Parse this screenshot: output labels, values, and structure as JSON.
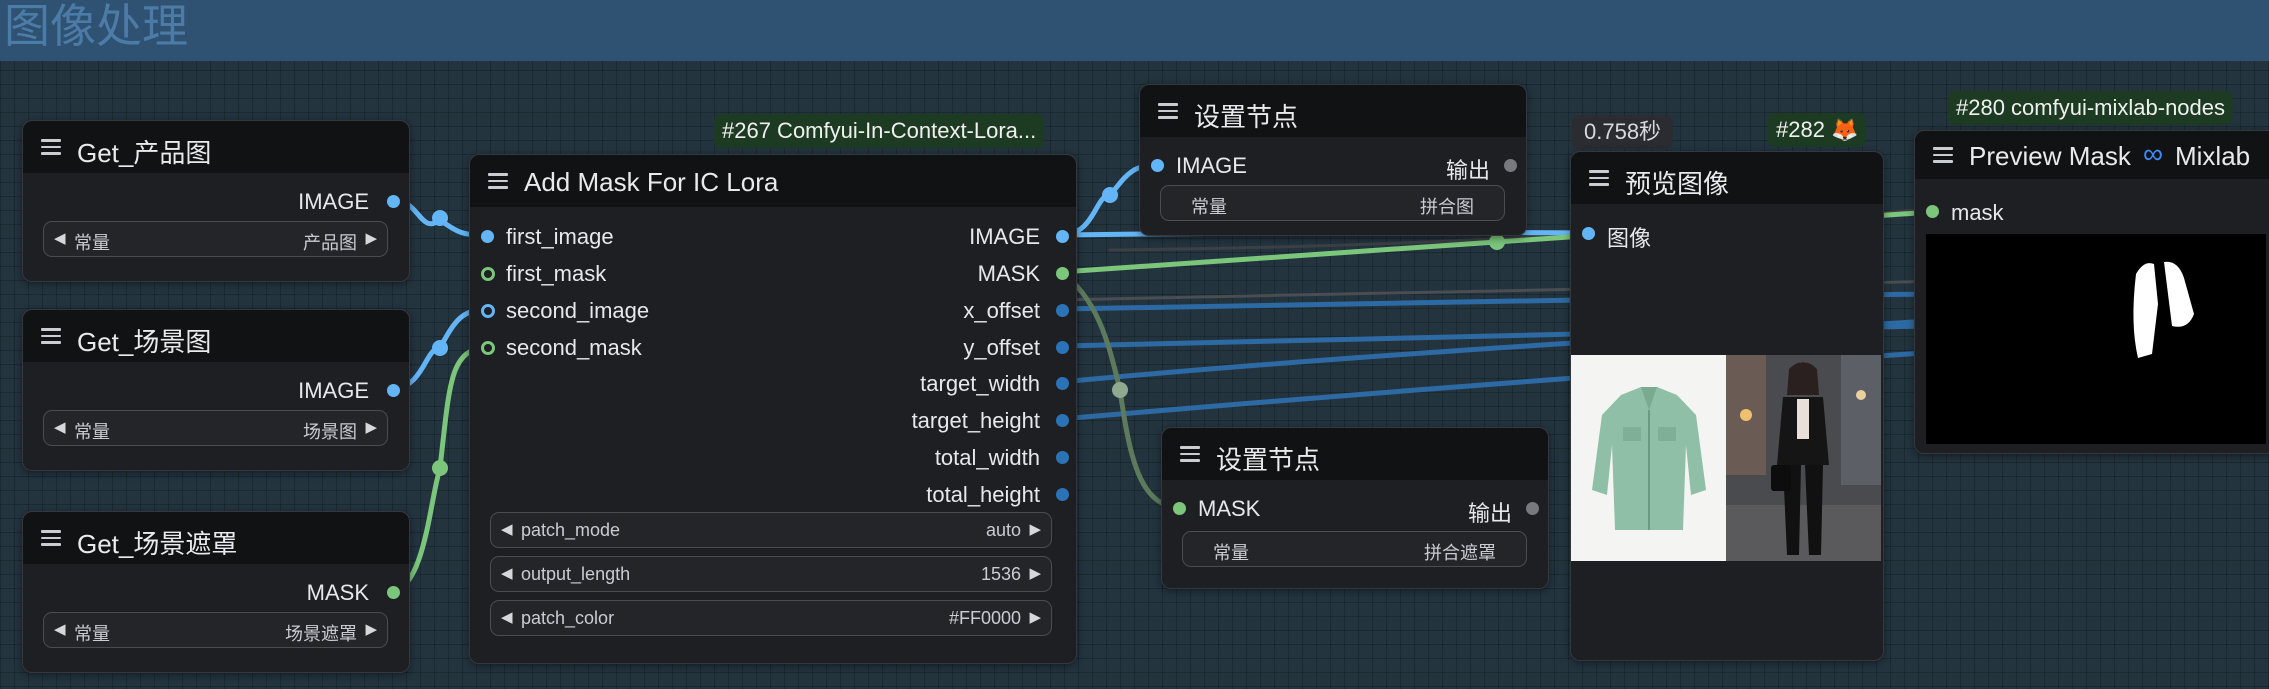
{
  "group": {
    "title": "图像处理"
  },
  "colors": {
    "image": "#64b5f6",
    "mask": "#7bc67b",
    "int": "#2b73b6",
    "badge_bg": "#1d3a22",
    "group_header": "#2f5272"
  },
  "nodes": {
    "get_product": {
      "title": "Get_产品图",
      "output": "IMAGE",
      "widget": {
        "label": "常量",
        "value": "产品图"
      }
    },
    "get_scene": {
      "title": "Get_场景图",
      "output": "IMAGE",
      "widget": {
        "label": "常量",
        "value": "场景图"
      }
    },
    "get_scene_mask": {
      "title": "Get_场景遮罩",
      "output": "MASK",
      "widget": {
        "label": "常量",
        "value": "场景遮罩"
      }
    },
    "add_mask": {
      "badge": "#267 Comfyui-In-Context-Lora...",
      "title": "Add Mask For IC Lora",
      "inputs": [
        "first_image",
        "first_mask",
        "second_image",
        "second_mask"
      ],
      "outputs": [
        "IMAGE",
        "MASK",
        "x_offset",
        "y_offset",
        "target_width",
        "target_height",
        "total_width",
        "total_height"
      ],
      "widgets": [
        {
          "label": "patch_mode",
          "value": "auto"
        },
        {
          "label": "output_length",
          "value": "1536"
        },
        {
          "label": "patch_color",
          "value": "#FF0000"
        }
      ]
    },
    "set_node_1": {
      "title": "设置节点",
      "input": "IMAGE",
      "output": "输出",
      "widget": {
        "label": "常量",
        "value": "拼合图"
      }
    },
    "set_node_2": {
      "title": "设置节点",
      "input": "MASK",
      "output": "输出",
      "widget": {
        "label": "常量",
        "value": "拼合遮罩"
      }
    },
    "preview_image": {
      "time": "0.758秒",
      "badge": "#282 🦊",
      "title": "预览图像",
      "input": "图像"
    },
    "preview_mask": {
      "badge": "#280 comfyui-mixlab-nodes",
      "title": "Preview Mask",
      "brand": "Mixlab",
      "input": "mask"
    }
  }
}
